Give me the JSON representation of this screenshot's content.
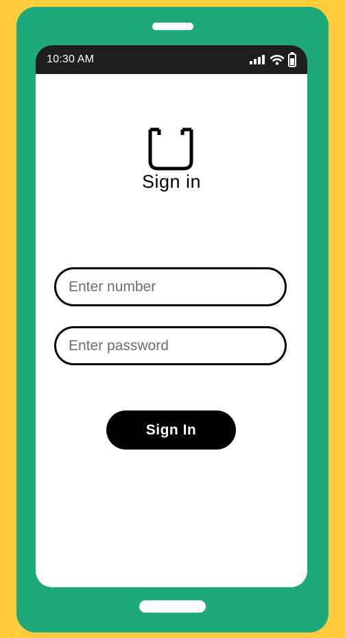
{
  "colors": {
    "background": "#FFCD3C",
    "phone_body": "#1EA97A",
    "status_bar": "#1E1E1E",
    "screen": "#FFFFFF",
    "button": "#000000",
    "button_text": "#FFFFFF"
  },
  "status_bar": {
    "time": "10:30 AM",
    "icons": [
      "signal-icon",
      "wifi-icon",
      "battery-icon"
    ]
  },
  "logo": {
    "icon": "bag-outline-icon"
  },
  "title": "Sign in",
  "form": {
    "number_field": {
      "value": "",
      "placeholder": "Enter number"
    },
    "password_field": {
      "value": "",
      "placeholder": "Enter password"
    },
    "submit_label": "Sign In"
  }
}
